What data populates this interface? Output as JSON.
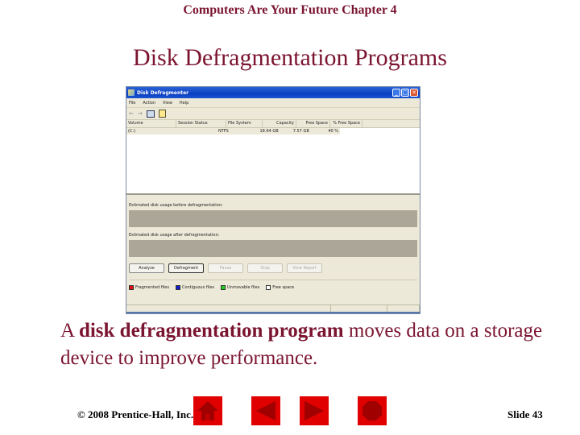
{
  "slide": {
    "header": "Computers Are Your Future  Chapter 4",
    "title": "Disk Defragmentation Programs",
    "body": {
      "prefix": "A ",
      "bold": "disk defragmentation program",
      "suffix": " moves data on a storage device to improve performance."
    },
    "copyright": "© 2008 Prentice-Hall, Inc.",
    "slide_number": "Slide 43",
    "nav_buttons": [
      "home",
      "previous",
      "next",
      "end"
    ]
  },
  "window": {
    "title": "Disk Defragmenter",
    "controls": {
      "minimize": "_",
      "maximize": "□",
      "close": "✕"
    },
    "menu": [
      "File",
      "Action",
      "View",
      "Help"
    ],
    "columns": [
      "Volume",
      "Session Status",
      "File System",
      "Capacity",
      "Free Space",
      "% Free Space"
    ],
    "rows": [
      {
        "volume": "(C:)",
        "status": "",
        "filesystem": "NTFS",
        "capacity": "18.64 GB",
        "free": "7.57 GB",
        "pct_free": "40 %"
      }
    ],
    "before_label": "Estimated disk usage before defragmentation:",
    "after_label": "Estimated disk usage after defragmentation:",
    "buttons": [
      {
        "label": "Analyze",
        "enabled": true
      },
      {
        "label": "Defragment",
        "enabled": true
      },
      {
        "label": "Pause",
        "enabled": false
      },
      {
        "label": "Stop",
        "enabled": false
      },
      {
        "label": "View Report",
        "enabled": false
      }
    ],
    "legend": [
      {
        "label": "Fragmented files",
        "color": "#e01010"
      },
      {
        "label": "Contiguous files",
        "color": "#1020d0"
      },
      {
        "label": "Unmovable files",
        "color": "#20d020"
      },
      {
        "label": "Free space",
        "color": "#ffffff"
      }
    ]
  }
}
